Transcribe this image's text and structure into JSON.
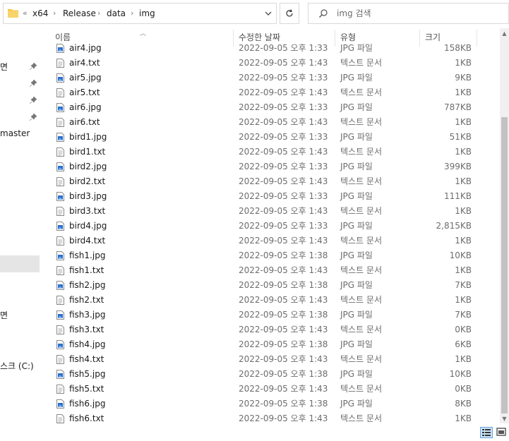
{
  "address": {
    "prefix": "«",
    "crumbs": [
      "x64",
      "Release",
      "data",
      "img"
    ],
    "separator": "›"
  },
  "search": {
    "placeholder": "img 검색"
  },
  "nav": {
    "items": [
      "면",
      "",
      "",
      "",
      "master",
      "",
      "면",
      "스크 (C:)"
    ]
  },
  "columns": {
    "name": "이름",
    "date": "수정한 날짜",
    "type": "유형",
    "size": "크기"
  },
  "files": [
    {
      "name": "air4.jpg",
      "date": "2022-09-05 오후 1:33",
      "type": "JPG 파일",
      "size": "158KB",
      "kind": "jpg"
    },
    {
      "name": "air4.txt",
      "date": "2022-09-05 오후 1:43",
      "type": "텍스트 문서",
      "size": "1KB",
      "kind": "txt"
    },
    {
      "name": "air5.jpg",
      "date": "2022-09-05 오후 1:33",
      "type": "JPG 파일",
      "size": "9KB",
      "kind": "jpg"
    },
    {
      "name": "air5.txt",
      "date": "2022-09-05 오후 1:43",
      "type": "텍스트 문서",
      "size": "1KB",
      "kind": "txt"
    },
    {
      "name": "air6.jpg",
      "date": "2022-09-05 오후 1:33",
      "type": "JPG 파일",
      "size": "787KB",
      "kind": "jpg"
    },
    {
      "name": "air6.txt",
      "date": "2022-09-05 오후 1:43",
      "type": "텍스트 문서",
      "size": "1KB",
      "kind": "txt"
    },
    {
      "name": "bird1.jpg",
      "date": "2022-09-05 오후 1:33",
      "type": "JPG 파일",
      "size": "51KB",
      "kind": "jpg"
    },
    {
      "name": "bird1.txt",
      "date": "2022-09-05 오후 1:43",
      "type": "텍스트 문서",
      "size": "1KB",
      "kind": "txt"
    },
    {
      "name": "bird2.jpg",
      "date": "2022-09-05 오후 1:33",
      "type": "JPG 파일",
      "size": "399KB",
      "kind": "jpg"
    },
    {
      "name": "bird2.txt",
      "date": "2022-09-05 오후 1:43",
      "type": "텍스트 문서",
      "size": "1KB",
      "kind": "txt"
    },
    {
      "name": "bird3.jpg",
      "date": "2022-09-05 오후 1:33",
      "type": "JPG 파일",
      "size": "111KB",
      "kind": "jpg"
    },
    {
      "name": "bird3.txt",
      "date": "2022-09-05 오후 1:43",
      "type": "텍스트 문서",
      "size": "1KB",
      "kind": "txt"
    },
    {
      "name": "bird4.jpg",
      "date": "2022-09-05 오후 1:33",
      "type": "JPG 파일",
      "size": "2,815KB",
      "kind": "jpg"
    },
    {
      "name": "bird4.txt",
      "date": "2022-09-05 오후 1:43",
      "type": "텍스트 문서",
      "size": "1KB",
      "kind": "txt"
    },
    {
      "name": "fish1.jpg",
      "date": "2022-09-05 오후 1:38",
      "type": "JPG 파일",
      "size": "10KB",
      "kind": "jpg"
    },
    {
      "name": "fish1.txt",
      "date": "2022-09-05 오후 1:43",
      "type": "텍스트 문서",
      "size": "1KB",
      "kind": "txt"
    },
    {
      "name": "fish2.jpg",
      "date": "2022-09-05 오후 1:38",
      "type": "JPG 파일",
      "size": "7KB",
      "kind": "jpg"
    },
    {
      "name": "fish2.txt",
      "date": "2022-09-05 오후 1:43",
      "type": "텍스트 문서",
      "size": "1KB",
      "kind": "txt"
    },
    {
      "name": "fish3.jpg",
      "date": "2022-09-05 오후 1:38",
      "type": "JPG 파일",
      "size": "7KB",
      "kind": "jpg"
    },
    {
      "name": "fish3.txt",
      "date": "2022-09-05 오후 1:43",
      "type": "텍스트 문서",
      "size": "0KB",
      "kind": "txt"
    },
    {
      "name": "fish4.jpg",
      "date": "2022-09-05 오후 1:38",
      "type": "JPG 파일",
      "size": "6KB",
      "kind": "jpg"
    },
    {
      "name": "fish4.txt",
      "date": "2022-09-05 오후 1:43",
      "type": "텍스트 문서",
      "size": "1KB",
      "kind": "txt"
    },
    {
      "name": "fish5.jpg",
      "date": "2022-09-05 오후 1:38",
      "type": "JPG 파일",
      "size": "10KB",
      "kind": "jpg"
    },
    {
      "name": "fish5.txt",
      "date": "2022-09-05 오후 1:43",
      "type": "텍스트 문서",
      "size": "0KB",
      "kind": "txt"
    },
    {
      "name": "fish6.jpg",
      "date": "2022-09-05 오후 1:38",
      "type": "JPG 파일",
      "size": "8KB",
      "kind": "jpg"
    },
    {
      "name": "fish6.txt",
      "date": "2022-09-05 오후 1:43",
      "type": "텍스트 문서",
      "size": "1KB",
      "kind": "txt"
    }
  ],
  "icons": {
    "folder": "folder-icon",
    "jpg": "image-file-icon",
    "txt": "text-file-icon"
  },
  "colors": {
    "folder": "#f6c744",
    "jpg_blue": "#2a6fd0",
    "border": "#d9d9d9",
    "selected": "#e5e5e5"
  }
}
